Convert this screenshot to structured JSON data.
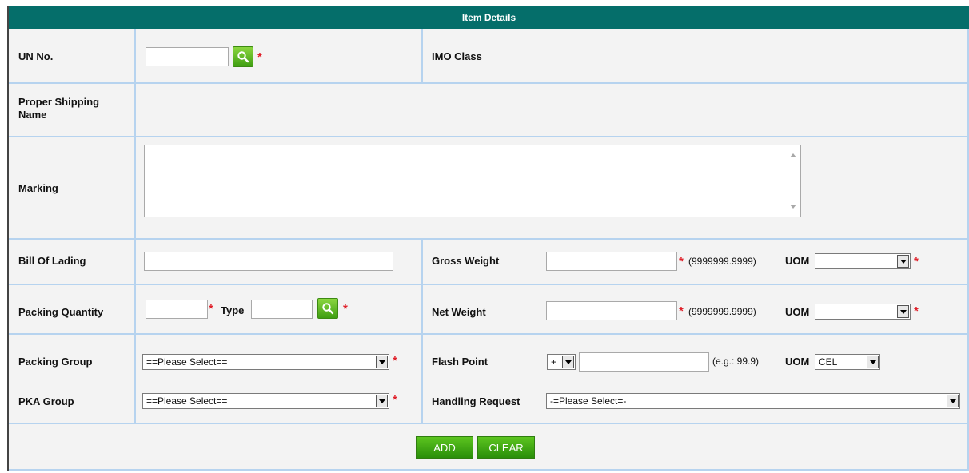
{
  "header": {
    "title": "Item Details"
  },
  "fields": {
    "un_no": {
      "label": "UN No.",
      "value": ""
    },
    "imo_class": {
      "label": "IMO Class"
    },
    "proper_shipping_name": {
      "label": "Proper Shipping Name"
    },
    "marking": {
      "label": "Marking",
      "value": ""
    },
    "bill_of_lading": {
      "label": "Bill Of Lading",
      "value": ""
    },
    "gross_weight": {
      "label": "Gross Weight",
      "value": "",
      "hint": "(9999999.9999)",
      "uom_label": "UOM",
      "uom_value": ""
    },
    "packing_quantity": {
      "label": "Packing Quantity",
      "value": "",
      "type_label": "Type",
      "type_value": ""
    },
    "net_weight": {
      "label": "Net Weight",
      "value": "",
      "hint": "(9999999.9999)",
      "uom_label": "UOM",
      "uom_value": ""
    },
    "packing_group": {
      "label": "Packing Group",
      "selected": "==Please Select=="
    },
    "flash_point": {
      "label": "Flash Point",
      "sign": "+",
      "value": "",
      "hint": "(e.g.: 99.9)",
      "uom_label": "UOM",
      "uom_value": "CEL"
    },
    "pka_group": {
      "label": "PKA Group",
      "selected": "==Please Select=="
    },
    "handling_request": {
      "label": "Handling Request",
      "selected": "-=Please Select=-"
    }
  },
  "buttons": {
    "add": "ADD",
    "clear": "CLEAR"
  },
  "required_marker": "*",
  "colors": {
    "header_bg": "#056e6a",
    "required": "#e0202a",
    "button_green": "#3fa612",
    "grid_line": "#b6d3ef",
    "panel_bg": "#f3f3f3"
  }
}
